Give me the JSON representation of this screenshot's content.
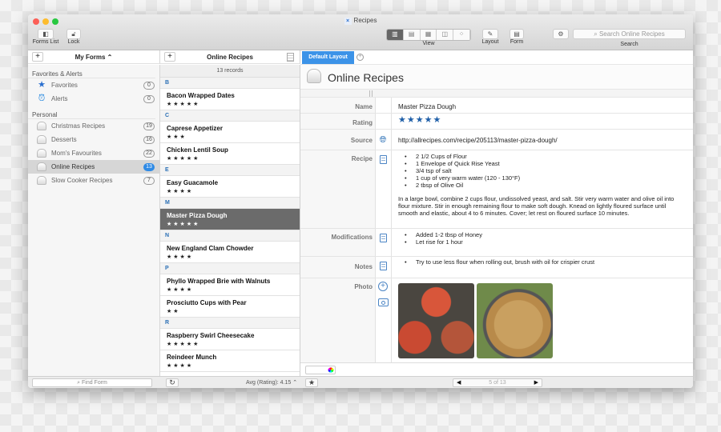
{
  "window": {
    "title": "Recipes"
  },
  "toolbar": {
    "forms_list": "Forms List",
    "lock": "Lock",
    "view": "View",
    "layout": "Layout",
    "form": "Form",
    "search": "Search",
    "search_placeholder": "Search Online Recipes"
  },
  "sidebar": {
    "header": "My Forms ⌃",
    "sections": [
      {
        "title": "Favorites & Alerts",
        "items": [
          {
            "label": "Favorites",
            "count": "0",
            "icon": "star-icon"
          },
          {
            "label": "Alerts",
            "count": "0",
            "icon": "alarm-clock-icon"
          }
        ]
      },
      {
        "title": "Personal",
        "items": [
          {
            "label": "Christmas Recipes",
            "count": "19"
          },
          {
            "label": "Desserts",
            "count": "16"
          },
          {
            "label": "Mom's Favourites",
            "count": "22"
          },
          {
            "label": "Online Recipes",
            "count": "13",
            "selected": true
          },
          {
            "label": "Slow Cooker Recipes",
            "count": "7"
          }
        ]
      }
    ],
    "find_placeholder": "Find Form"
  },
  "list": {
    "title": "Online Recipes",
    "records": "13 records",
    "avg": "Avg (Rating): 4.15 ⌃",
    "groups": [
      {
        "letter": "B",
        "items": [
          {
            "name": "Bacon Wrapped Dates",
            "stars": "★★★★★"
          }
        ]
      },
      {
        "letter": "C",
        "items": [
          {
            "name": "Caprese Appetizer",
            "stars": "★★★"
          },
          {
            "name": "Chicken Lentil Soup",
            "stars": "★★★★★"
          }
        ]
      },
      {
        "letter": "E",
        "items": [
          {
            "name": "Easy Guacamole",
            "stars": "★★★★"
          }
        ]
      },
      {
        "letter": "M",
        "items": [
          {
            "name": "Master Pizza Dough",
            "stars": "★★★★★",
            "selected": true
          }
        ]
      },
      {
        "letter": "N",
        "items": [
          {
            "name": "New England Clam Chowder",
            "stars": "★★★★"
          }
        ]
      },
      {
        "letter": "P",
        "items": [
          {
            "name": "Phyllo Wrapped Brie with Walnuts",
            "stars": "★★★★"
          },
          {
            "name": "Prosciutto Cups with Pear",
            "stars": "★★"
          }
        ]
      },
      {
        "letter": "R",
        "items": [
          {
            "name": "Raspberry Swirl Cheesecake",
            "stars": "★★★★★"
          },
          {
            "name": "Reindeer Munch",
            "stars": "★★★★"
          }
        ]
      }
    ]
  },
  "detail": {
    "tab": "Default Layout",
    "form_title": "Online Recipes",
    "labels": {
      "name": "Name",
      "rating": "Rating",
      "source": "Source",
      "recipe": "Recipe",
      "modifications": "Modifications",
      "notes": "Notes",
      "photo": "Photo"
    },
    "name": "Master Pizza Dough",
    "rating": 5,
    "rating_stars": "★★★★★",
    "source": "http://allrecipes.com/recipe/205113/master-pizza-dough/",
    "ingredients": [
      "2 1/2 Cups of Flour",
      "1 Envelope of Quick Rise Yeast",
      "3/4 tsp of salt",
      "1 cup of very warm water (120 - 130°F)",
      "2 tbsp of Olive Oil"
    ],
    "directions": "In a large bowl, combine 2 cups flour, undissolved yeast, and salt. Stir very warm water and olive oil into flour mixture. Stir in enough remaining flour to make soft dough. Knead on lightly floured surface until smooth and elastic, about 4 to 6 minutes. Cover; let rest on floured surface 10 minutes.",
    "modifications": [
      "Added 1-2 tbsp of Honey",
      "Let rise for 1 hour"
    ],
    "notes": [
      "Try to use less flour when rolling out, brush with oil for crispier crust"
    ],
    "pager": "5 of 13"
  },
  "colors": {
    "accent": "#3c93e8",
    "star": "#1f5fa8",
    "selected_row": "#6b6b6b"
  }
}
